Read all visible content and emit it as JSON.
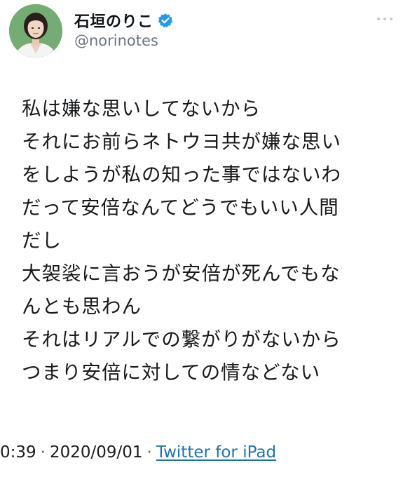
{
  "user": {
    "display_name": "石垣のりこ",
    "handle": "@norinotes",
    "verified_icon": "verified-badge-icon",
    "avatar_icon": "profile-photo"
  },
  "tweet": {
    "lines": [
      "私は嫌な思いしてないから",
      "それにお前らネトウヨ共が嫌な思い",
      "をしようが私の知った事ではないわ",
      "だって安倍なんてどうでもいい人間",
      "だし",
      "大袈裟に言おうが安倍が死んでもな",
      "んとも思わん",
      "それはリアルでの繋がりがないから",
      "つまり安倍に対しての情などない"
    ],
    "time": "0:39",
    "date": "2020/09/01",
    "separator": "·",
    "source": "Twitter for iPad"
  },
  "colors": {
    "verified": "#1d9bf0",
    "link": "#1d73b8",
    "handle": "#6b7680"
  }
}
